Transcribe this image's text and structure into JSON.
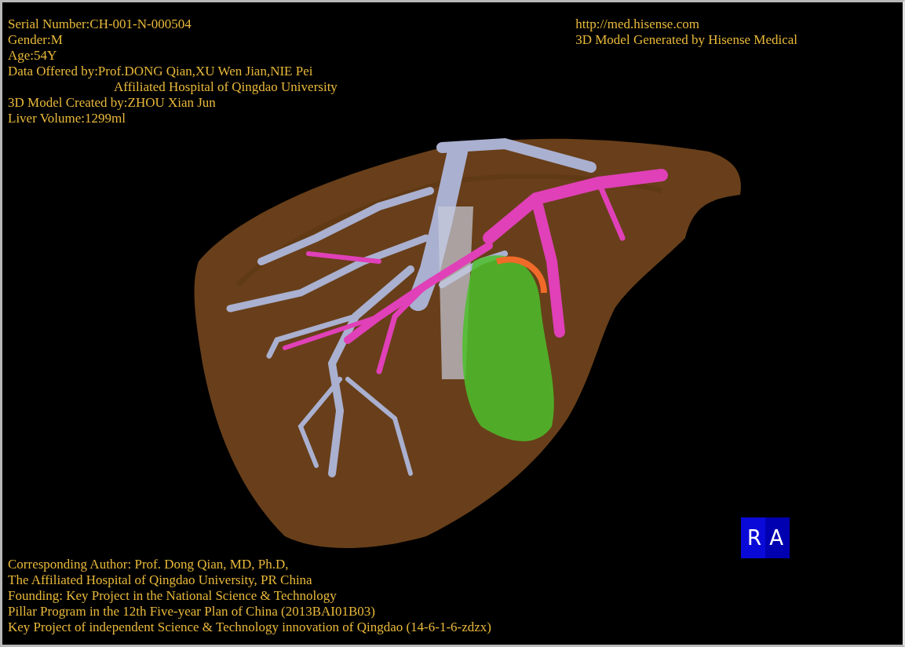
{
  "info_left": [
    {
      "text": "Serial Number:CH-001-N-000504",
      "kind": "line"
    },
    {
      "text": "Gender:M",
      "kind": "line"
    },
    {
      "text": "Age:54Y",
      "kind": "line"
    },
    {
      "text": "Data Offered by:Prof.DONG Qian,XU Wen Jian,NIE Pei",
      "kind": "line"
    },
    {
      "text": "Affiliated Hospital of Qingdao University",
      "kind": "continuation"
    },
    {
      "text": "3D Model Created by:ZHOU Xian Jun",
      "kind": "line"
    },
    {
      "text": "Liver Volume:1299ml",
      "kind": "line"
    }
  ],
  "info_right": [
    "http://med.hisense.com",
    "3D Model Generated by Hisense Medical"
  ],
  "credits": [
    "Corresponding Author: Prof. Dong Qian, MD, Ph.D,",
    "The Affiliated Hospital of Qingdao University, PR China",
    "Founding: Key Project in the National Science & Technology",
    "Pillar Program in the 12th Five-year Plan of China (2013BAI01B03)",
    "Key Project of independent Science & Technology innovation of Qingdao (14-6-1-6-zdzx)"
  ],
  "orientation_cube": {
    "left_face": "R",
    "right_face": "A"
  }
}
